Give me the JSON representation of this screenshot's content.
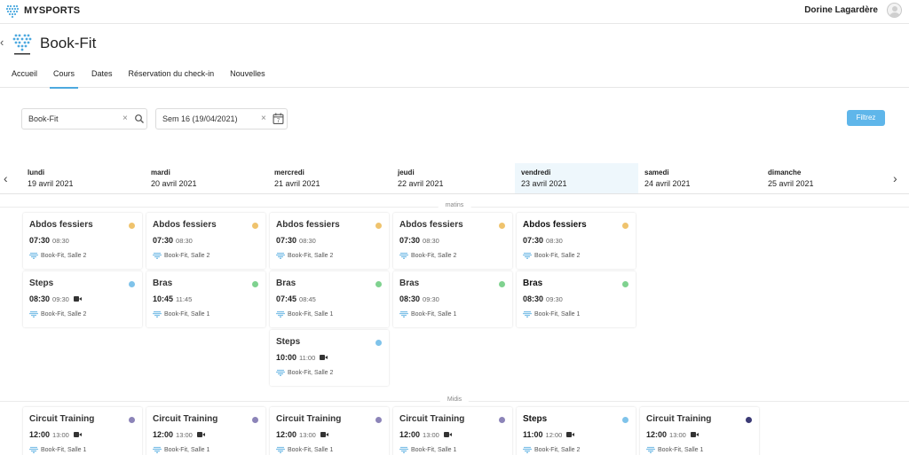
{
  "app": {
    "name": "MYSPORTS"
  },
  "user": {
    "name": "Dorine Lagardère"
  },
  "club": {
    "title": "Book-Fit"
  },
  "tabs": [
    {
      "label": "Accueil"
    },
    {
      "label": "Cours",
      "active": true
    },
    {
      "label": "Dates"
    },
    {
      "label": "Réservation du check-in"
    },
    {
      "label": "Nouvelles"
    }
  ],
  "filters": {
    "club_value": "Book-Fit",
    "week_value": "Sem 16 (19/04/2021)",
    "week_calendar_number": "7",
    "submit_label": "Filtrez"
  },
  "days": [
    {
      "name": "lundi",
      "date": "19 avril 2021"
    },
    {
      "name": "mardi",
      "date": "20 avril 2021"
    },
    {
      "name": "mercredi",
      "date": "21 avril 2021"
    },
    {
      "name": "jeudi",
      "date": "22 avril 2021"
    },
    {
      "name": "vendredi",
      "date": "23 avril 2021",
      "today": true
    },
    {
      "name": "samedi",
      "date": "24 avril 2021"
    },
    {
      "name": "dimanche",
      "date": "25 avril 2021"
    }
  ],
  "sections": {
    "morning": "matins",
    "noon": "Midis"
  },
  "colors": {
    "yellow": "#efc36d",
    "blue": "#7fc3ea",
    "green": "#7fd28f",
    "purple": "#8c84b8",
    "navy": "#3b3a75",
    "accent": "#5fb6ea"
  },
  "classes": [
    {
      "day": 0,
      "row": 0,
      "section": "morning",
      "title": "Abdos fessiers",
      "start": "07:30",
      "end": "08:30",
      "location": "Book-Fit, Salle 2",
      "color": "yellow",
      "video": false
    },
    {
      "day": 1,
      "row": 0,
      "section": "morning",
      "title": "Abdos fessiers",
      "start": "07:30",
      "end": "08:30",
      "location": "Book-Fit, Salle 2",
      "color": "yellow",
      "video": false
    },
    {
      "day": 2,
      "row": 0,
      "section": "morning",
      "title": "Abdos fessiers",
      "start": "07:30",
      "end": "08:30",
      "location": "Book-Fit, Salle 2",
      "color": "yellow",
      "video": false
    },
    {
      "day": 3,
      "row": 0,
      "section": "morning",
      "title": "Abdos fessiers",
      "start": "07:30",
      "end": "08:30",
      "location": "Book-Fit, Salle 2",
      "color": "yellow",
      "video": false
    },
    {
      "day": 4,
      "row": 0,
      "section": "morning",
      "title": "Abdos fessiers",
      "start": "07:30",
      "end": "08:30",
      "location": "Book-Fit, Salle 2",
      "color": "yellow",
      "video": false
    },
    {
      "day": 0,
      "row": 1,
      "section": "morning",
      "title": "Steps",
      "start": "08:30",
      "end": "09:30",
      "location": "Book-Fit, Salle 2",
      "color": "blue",
      "video": true
    },
    {
      "day": 1,
      "row": 1,
      "section": "morning",
      "title": "Bras",
      "start": "10:45",
      "end": "11:45",
      "location": "Book-Fit, Salle 1",
      "color": "green",
      "video": false
    },
    {
      "day": 2,
      "row": 1,
      "section": "morning",
      "title": "Bras",
      "start": "07:45",
      "end": "08:45",
      "location": "Book-Fit, Salle 1",
      "color": "green",
      "video": false
    },
    {
      "day": 3,
      "row": 1,
      "section": "morning",
      "title": "Bras",
      "start": "08:30",
      "end": "09:30",
      "location": "Book-Fit, Salle 1",
      "color": "green",
      "video": false
    },
    {
      "day": 4,
      "row": 1,
      "section": "morning",
      "title": "Bras",
      "start": "08:30",
      "end": "09:30",
      "location": "Book-Fit, Salle 1",
      "color": "green",
      "video": false
    },
    {
      "day": 2,
      "row": 2,
      "section": "morning",
      "title": "Steps",
      "start": "10:00",
      "end": "11:00",
      "location": "Book-Fit, Salle 2",
      "color": "blue",
      "video": true
    },
    {
      "day": 0,
      "row": 0,
      "section": "noon",
      "title": "Circuit Training",
      "start": "12:00",
      "end": "13:00",
      "location": "Book-Fit, Salle 1",
      "color": "purple",
      "video": true
    },
    {
      "day": 1,
      "row": 0,
      "section": "noon",
      "title": "Circuit Training",
      "start": "12:00",
      "end": "13:00",
      "location": "Book-Fit, Salle 1",
      "color": "purple",
      "video": true
    },
    {
      "day": 2,
      "row": 0,
      "section": "noon",
      "title": "Circuit Training",
      "start": "12:00",
      "end": "13:00",
      "location": "Book-Fit, Salle 1",
      "color": "purple",
      "video": true
    },
    {
      "day": 3,
      "row": 0,
      "section": "noon",
      "title": "Circuit Training",
      "start": "12:00",
      "end": "13:00",
      "location": "Book-Fit, Salle 1",
      "color": "purple",
      "video": true
    },
    {
      "day": 4,
      "row": 0,
      "section": "noon",
      "title": "Steps",
      "start": "11:00",
      "end": "12:00",
      "location": "Book-Fit, Salle 2",
      "color": "blue",
      "video": true
    },
    {
      "day": 5,
      "row": 0,
      "section": "noon",
      "title": "Circuit Training",
      "start": "12:00",
      "end": "13:00",
      "location": "Book-Fit, Salle 1",
      "color": "navy",
      "video": true
    }
  ]
}
